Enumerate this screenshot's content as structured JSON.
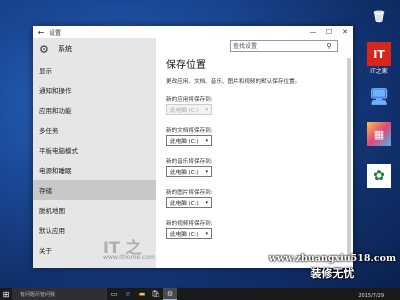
{
  "desktop": {
    "icons": [
      {
        "label": "",
        "glyph": "🗑",
        "color": "#dfe6ef"
      },
      {
        "label": "IT之家",
        "glyph": "IT",
        "color": "#d9261c"
      },
      {
        "label": "",
        "glyph": "🖥",
        "color": "#3a86d8"
      },
      {
        "label": "",
        "glyph": "▦",
        "color": "#e8e8e8"
      },
      {
        "label": "",
        "glyph": "✿",
        "color": "#1f7a3a"
      }
    ]
  },
  "window": {
    "title": "设置",
    "controls": {
      "minimize": "—",
      "maximize": "☐",
      "close": "✕"
    }
  },
  "search": {
    "placeholder": "查找设置"
  },
  "sidebar": {
    "header": "系统",
    "items": [
      {
        "label": "显示"
      },
      {
        "label": "通知和操作"
      },
      {
        "label": "应用和功能"
      },
      {
        "label": "多任务"
      },
      {
        "label": "平板电脑模式"
      },
      {
        "label": "电源和睡眠"
      },
      {
        "label": "存储",
        "active": true
      },
      {
        "label": "脱机地图"
      },
      {
        "label": "默认应用"
      },
      {
        "label": "关于"
      }
    ]
  },
  "main": {
    "title": "保存位置",
    "description": "更改应用、文档、音乐、图片和视频的默认保存位置。",
    "fields": [
      {
        "label": "新的应用将保存到:",
        "value": "此电脑 (C:)",
        "disabled": true
      },
      {
        "label": "新的文档将保存到:",
        "value": "此电脑 (C:)"
      },
      {
        "label": "新的音乐将保存到:",
        "value": "此电脑 (C:)"
      },
      {
        "label": "新的图片将保存到:",
        "value": "此电脑 (C:)"
      },
      {
        "label": "新的视频将保存到:",
        "value": "此电脑 (C:)"
      }
    ]
  },
  "watermarks": {
    "it_logo": "IT 之",
    "ithome_url": "www.ithome.com",
    "site_url": "www.zhuangxiu518.com",
    "site_name": "装修无忧"
  },
  "taskbar": {
    "search_text": "有问题尽管问我",
    "time": "2015/7/29"
  }
}
